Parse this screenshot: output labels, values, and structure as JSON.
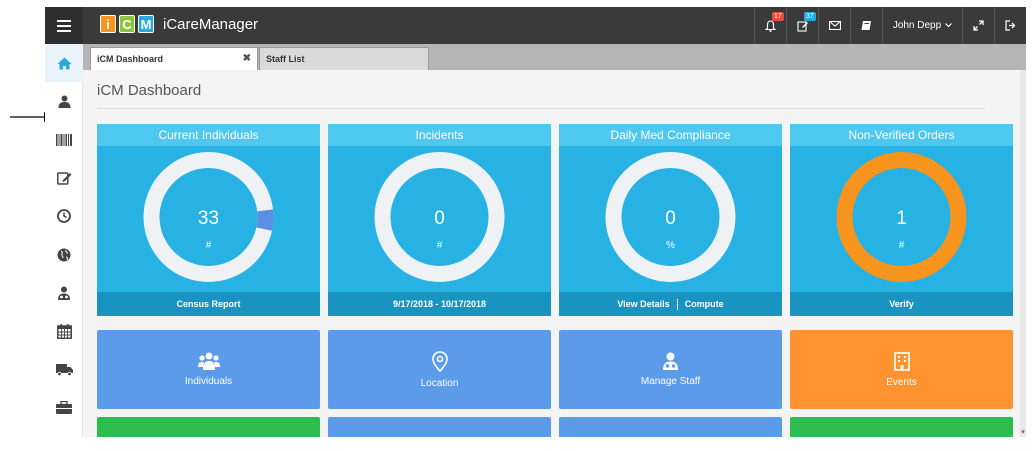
{
  "app": {
    "tiles": [
      "i",
      "C",
      "M"
    ],
    "tile_colors": [
      "#f7941d",
      "#8cc63f",
      "#27aae1"
    ],
    "brand": "iCareManager"
  },
  "header": {
    "notifications_count": "17",
    "tasks_count": "37",
    "user_name": "John Depp",
    "badge_colors": {
      "notifications": "#e74c3c",
      "tasks": "#27aae1"
    }
  },
  "sidebar": {
    "items": [
      "home-icon",
      "user-icon",
      "barcode-icon",
      "edit-icon",
      "clock-icon",
      "globe-icon",
      "staff-icon",
      "calendar-icon",
      "truck-icon",
      "briefcase-icon"
    ]
  },
  "tabs": [
    {
      "label": "iCM Dashboard",
      "close": "✖"
    },
    {
      "label": "Staff List"
    }
  ],
  "page": {
    "title": "iCM Dashboard"
  },
  "cards": [
    {
      "title": "Current Individuals",
      "value": "33",
      "unit": "#",
      "foot": [
        "Census Report"
      ],
      "ring_color": "#eef2f5",
      "progress_color": "#5b8fe6"
    },
    {
      "title": "Incidents",
      "value": "0",
      "unit": "#",
      "foot": [
        "9/17/2018 - 10/17/2018"
      ],
      "ring_color": "#eef2f5"
    },
    {
      "title": "Daily Med Compliance",
      "value": "0",
      "unit": "%",
      "foot": [
        "View Details",
        "Compute"
      ],
      "ring_color": "#eef2f5"
    },
    {
      "title": "Non-Verified Orders",
      "value": "1",
      "unit": "#",
      "foot": [
        "Verify"
      ],
      "ring_color": "#f7941d"
    }
  ],
  "tiles": [
    {
      "label": "Individuals",
      "icon": "users-icon",
      "color": "#5b9bea"
    },
    {
      "label": "Location",
      "icon": "location-icon",
      "color": "#5b9bea"
    },
    {
      "label": "Manage Staff",
      "icon": "staff-icon",
      "color": "#5b9bea"
    },
    {
      "label": "Events",
      "icon": "building-icon",
      "color": "#ff9330"
    }
  ],
  "tiles_row2_colors": [
    "#2dbc4e",
    "#5b9bea",
    "#5b9bea",
    "#2dbc4e"
  ]
}
